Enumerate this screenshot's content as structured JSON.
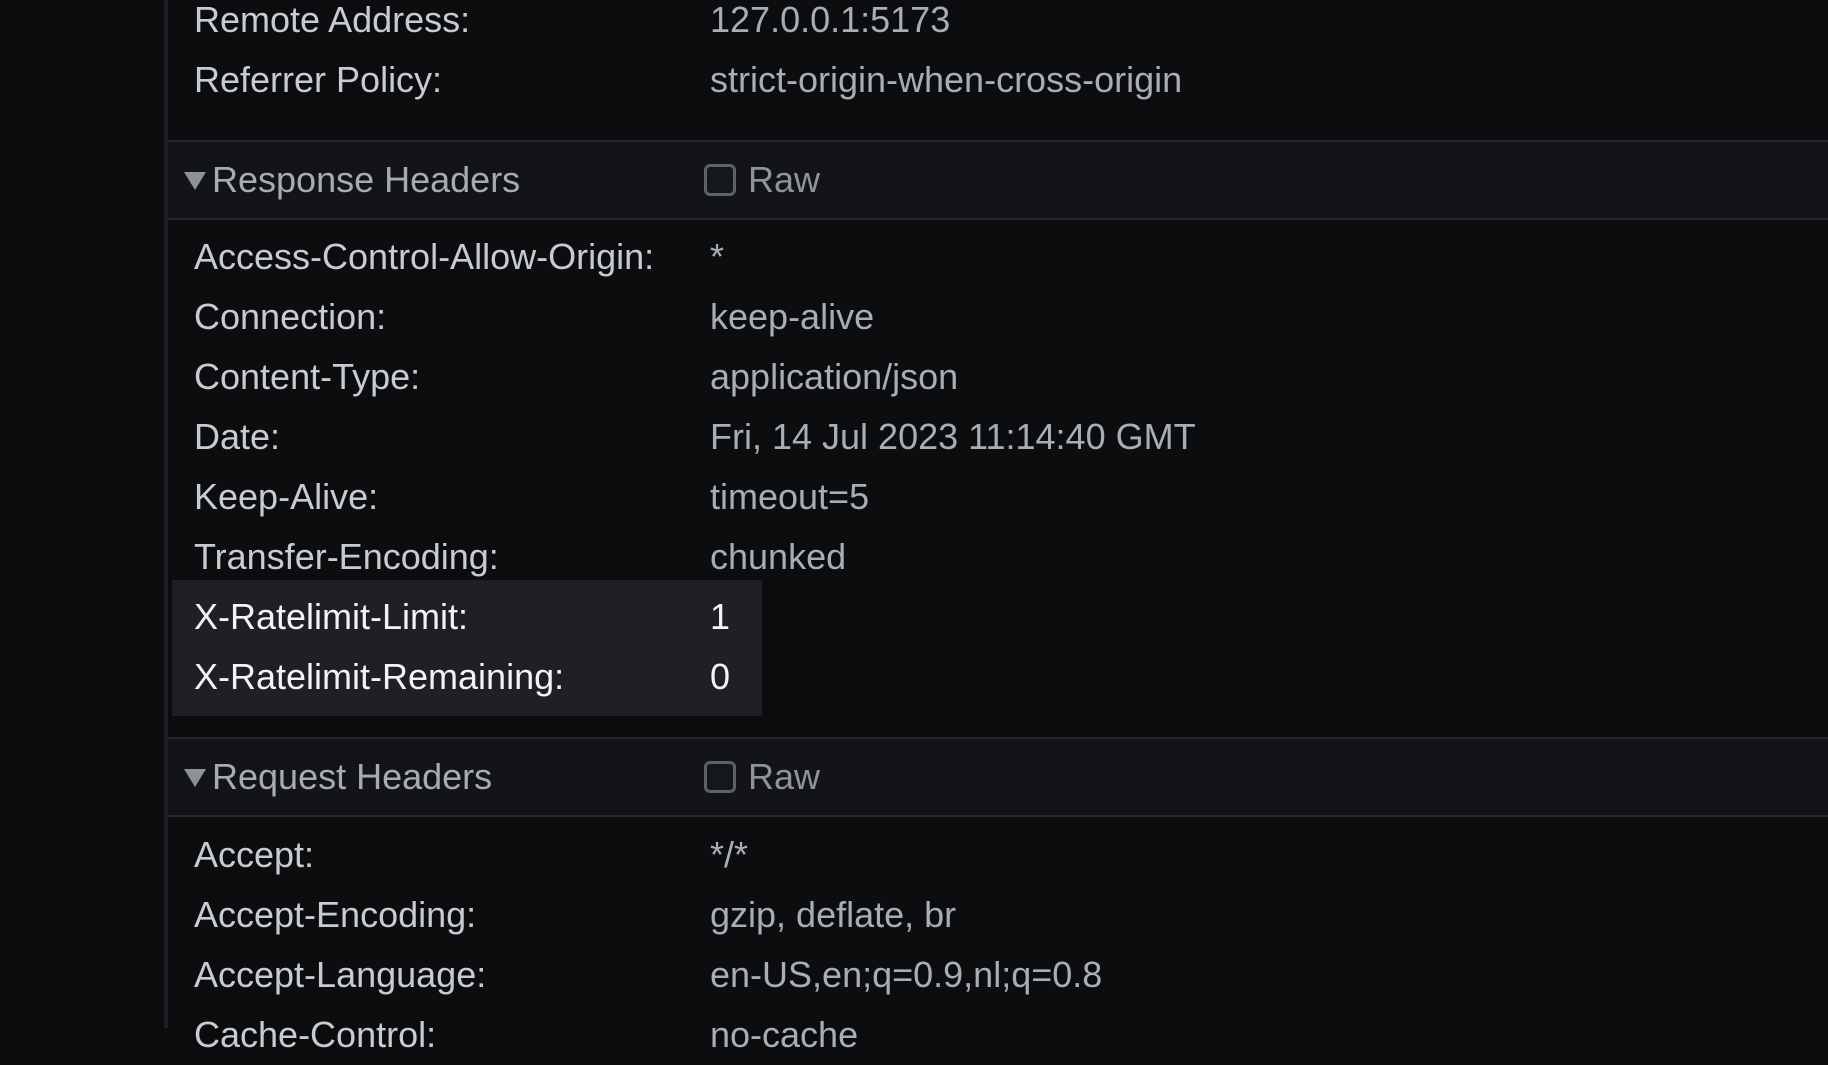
{
  "general": {
    "rows": [
      {
        "key": "Remote Address:",
        "value": "127.0.0.1:5173"
      },
      {
        "key": "Referrer Policy:",
        "value": "strict-origin-when-cross-origin"
      }
    ]
  },
  "response_headers": {
    "title": "Response Headers",
    "raw_label": "Raw",
    "raw_checked": false,
    "rows": [
      {
        "key": "Access-Control-Allow-Origin:",
        "value": "*"
      },
      {
        "key": "Connection:",
        "value": "keep-alive"
      },
      {
        "key": "Content-Type:",
        "value": "application/json"
      },
      {
        "key": "Date:",
        "value": "Fri, 14 Jul 2023 11:14:40 GMT"
      },
      {
        "key": "Keep-Alive:",
        "value": "timeout=5"
      },
      {
        "key": "Transfer-Encoding:",
        "value": "chunked"
      },
      {
        "key": "X-Ratelimit-Limit:",
        "value": "1"
      },
      {
        "key": "X-Ratelimit-Remaining:",
        "value": "0"
      }
    ]
  },
  "request_headers": {
    "title": "Request Headers",
    "raw_label": "Raw",
    "raw_checked": false,
    "rows": [
      {
        "key": "Accept:",
        "value": "*/*"
      },
      {
        "key": "Accept-Encoding:",
        "value": "gzip, deflate, br"
      },
      {
        "key": "Accept-Language:",
        "value": "en-US,en;q=0.9,nl;q=0.8"
      },
      {
        "key": "Cache-Control:",
        "value": "no-cache"
      }
    ]
  },
  "colors": {
    "background": "#0c0d0f",
    "highlight": "#1f2024",
    "header_bg": "#131417"
  }
}
